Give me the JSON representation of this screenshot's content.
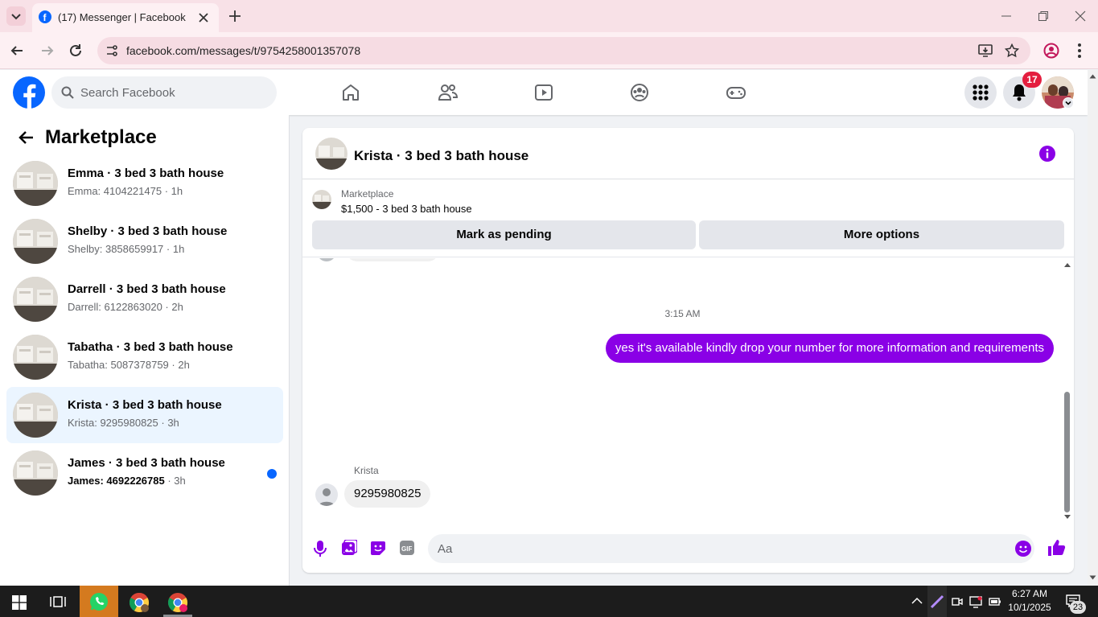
{
  "browser": {
    "tab_title": "(17) Messenger | Facebook",
    "url": "facebook.com/messages/t/9754258001357078"
  },
  "header": {
    "search_placeholder": "Search Facebook",
    "notification_count": "17",
    "brand_color": "#0866ff"
  },
  "sidebar": {
    "title": "Marketplace",
    "conversations": [
      {
        "name": "Emma · 3 bed 3 bath house",
        "preview": "Emma: 4104221475",
        "time": " · 1h",
        "active": false,
        "unread": false
      },
      {
        "name": "Shelby · 3 bed 3 bath house",
        "preview": "Shelby: 3858659917",
        "time": " · 1h",
        "active": false,
        "unread": false
      },
      {
        "name": "Darrell · 3 bed 3 bath house",
        "preview": "Darrell: 6122863020",
        "time": " · 2h",
        "active": false,
        "unread": false
      },
      {
        "name": "Tabatha · 3 bed 3 bath house",
        "preview": "Tabatha: 5087378759",
        "time": " · 2h",
        "active": false,
        "unread": false
      },
      {
        "name": "Krista · 3 bed 3 bath house",
        "preview": "Krista: 9295980825",
        "time": " · 3h",
        "active": true,
        "unread": false
      },
      {
        "name": "James · 3 bed 3 bath house",
        "preview": "James: 4692226785",
        "time": " · 3h",
        "active": false,
        "unread": true
      }
    ]
  },
  "chat": {
    "title": "Krista · 3 bed 3 bath house",
    "listing_label": "Marketplace",
    "listing_text": "$1,500 - 3 bed 3 bath house",
    "mark_pending_label": "Mark as pending",
    "more_options_label": "More options",
    "timestamp": "3:15 AM",
    "outgoing_message": "yes it's available kindly drop your number for more information and requirements",
    "sender_name": "Krista",
    "incoming_message": "9295980825",
    "composer_placeholder": "Aa",
    "accent_color": "#8a00e6"
  },
  "taskbar": {
    "time": "6:27 AM",
    "date": "10/1/2025",
    "notification_count": "23"
  }
}
